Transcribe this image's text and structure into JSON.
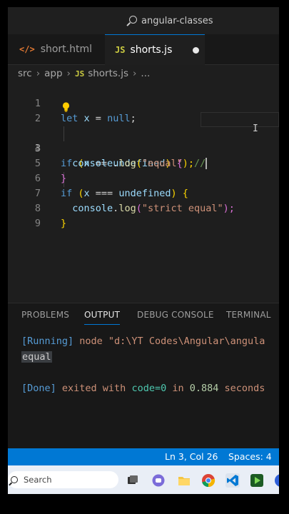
{
  "titlebar": {
    "search_text": "angular-classes"
  },
  "tabs": [
    {
      "label": "short.html",
      "icon": "html-file-icon"
    },
    {
      "label": "shorts.js",
      "icon": "js-file-icon",
      "active": true,
      "unsaved": true
    }
  ],
  "breadcrumb": {
    "parts": [
      "src",
      "app",
      "shorts.js",
      "..."
    ]
  },
  "editor": {
    "line_numbers": [
      "1",
      "2",
      "3",
      "4",
      "5",
      "6",
      "7",
      "8",
      "9"
    ],
    "active_line": "3",
    "lines": [
      {
        "kw": "let",
        "var": "x",
        "op": " = ",
        "val": "null",
        "end": ";"
      },
      {},
      {
        "kw": "if",
        "open": " (",
        "var": "x",
        "op": " == ",
        "val": "undefined",
        "close": ") ",
        "brace": "{",
        "comment": "  //"
      },
      {
        "obj": "console",
        "dot": ".",
        "fn": "log",
        "open": "(",
        "str": "\"equal\"",
        "close": ");"
      },
      {
        "brace": "}"
      },
      {
        "kw": "if",
        "open": " (",
        "var": "x",
        "op": " === ",
        "val": "undefined",
        "close": ") ",
        "brace": "{"
      },
      {
        "obj": "console",
        "dot": ".",
        "fn": "log",
        "open": "(",
        "str": "\"strict equal\"",
        "close": ");"
      },
      {
        "brace": "}"
      },
      {}
    ]
  },
  "panel": {
    "tabs": [
      "PROBLEMS",
      "OUTPUT",
      "DEBUG CONSOLE",
      "TERMINAL"
    ],
    "active_tab": "OUTPUT",
    "output": {
      "running_tag": "[Running]",
      "running_cmd": " node \"d:\\YT Codes\\Angular\\angula",
      "result": "equal",
      "done_tag": "[Done]",
      "done_text1": " exited with ",
      "done_code": "code=0",
      "done_text2": " in ",
      "done_time": "0.884",
      "done_text3": " seconds"
    }
  },
  "statusbar": {
    "position": "Ln 3, Col 26",
    "spaces": "Spaces: 4"
  },
  "taskbar": {
    "search_placeholder": "Search"
  },
  "colors": {
    "accent": "#0078d4",
    "keyword": "#569cd6",
    "string": "#ce9178",
    "function": "#dcdcaa"
  }
}
